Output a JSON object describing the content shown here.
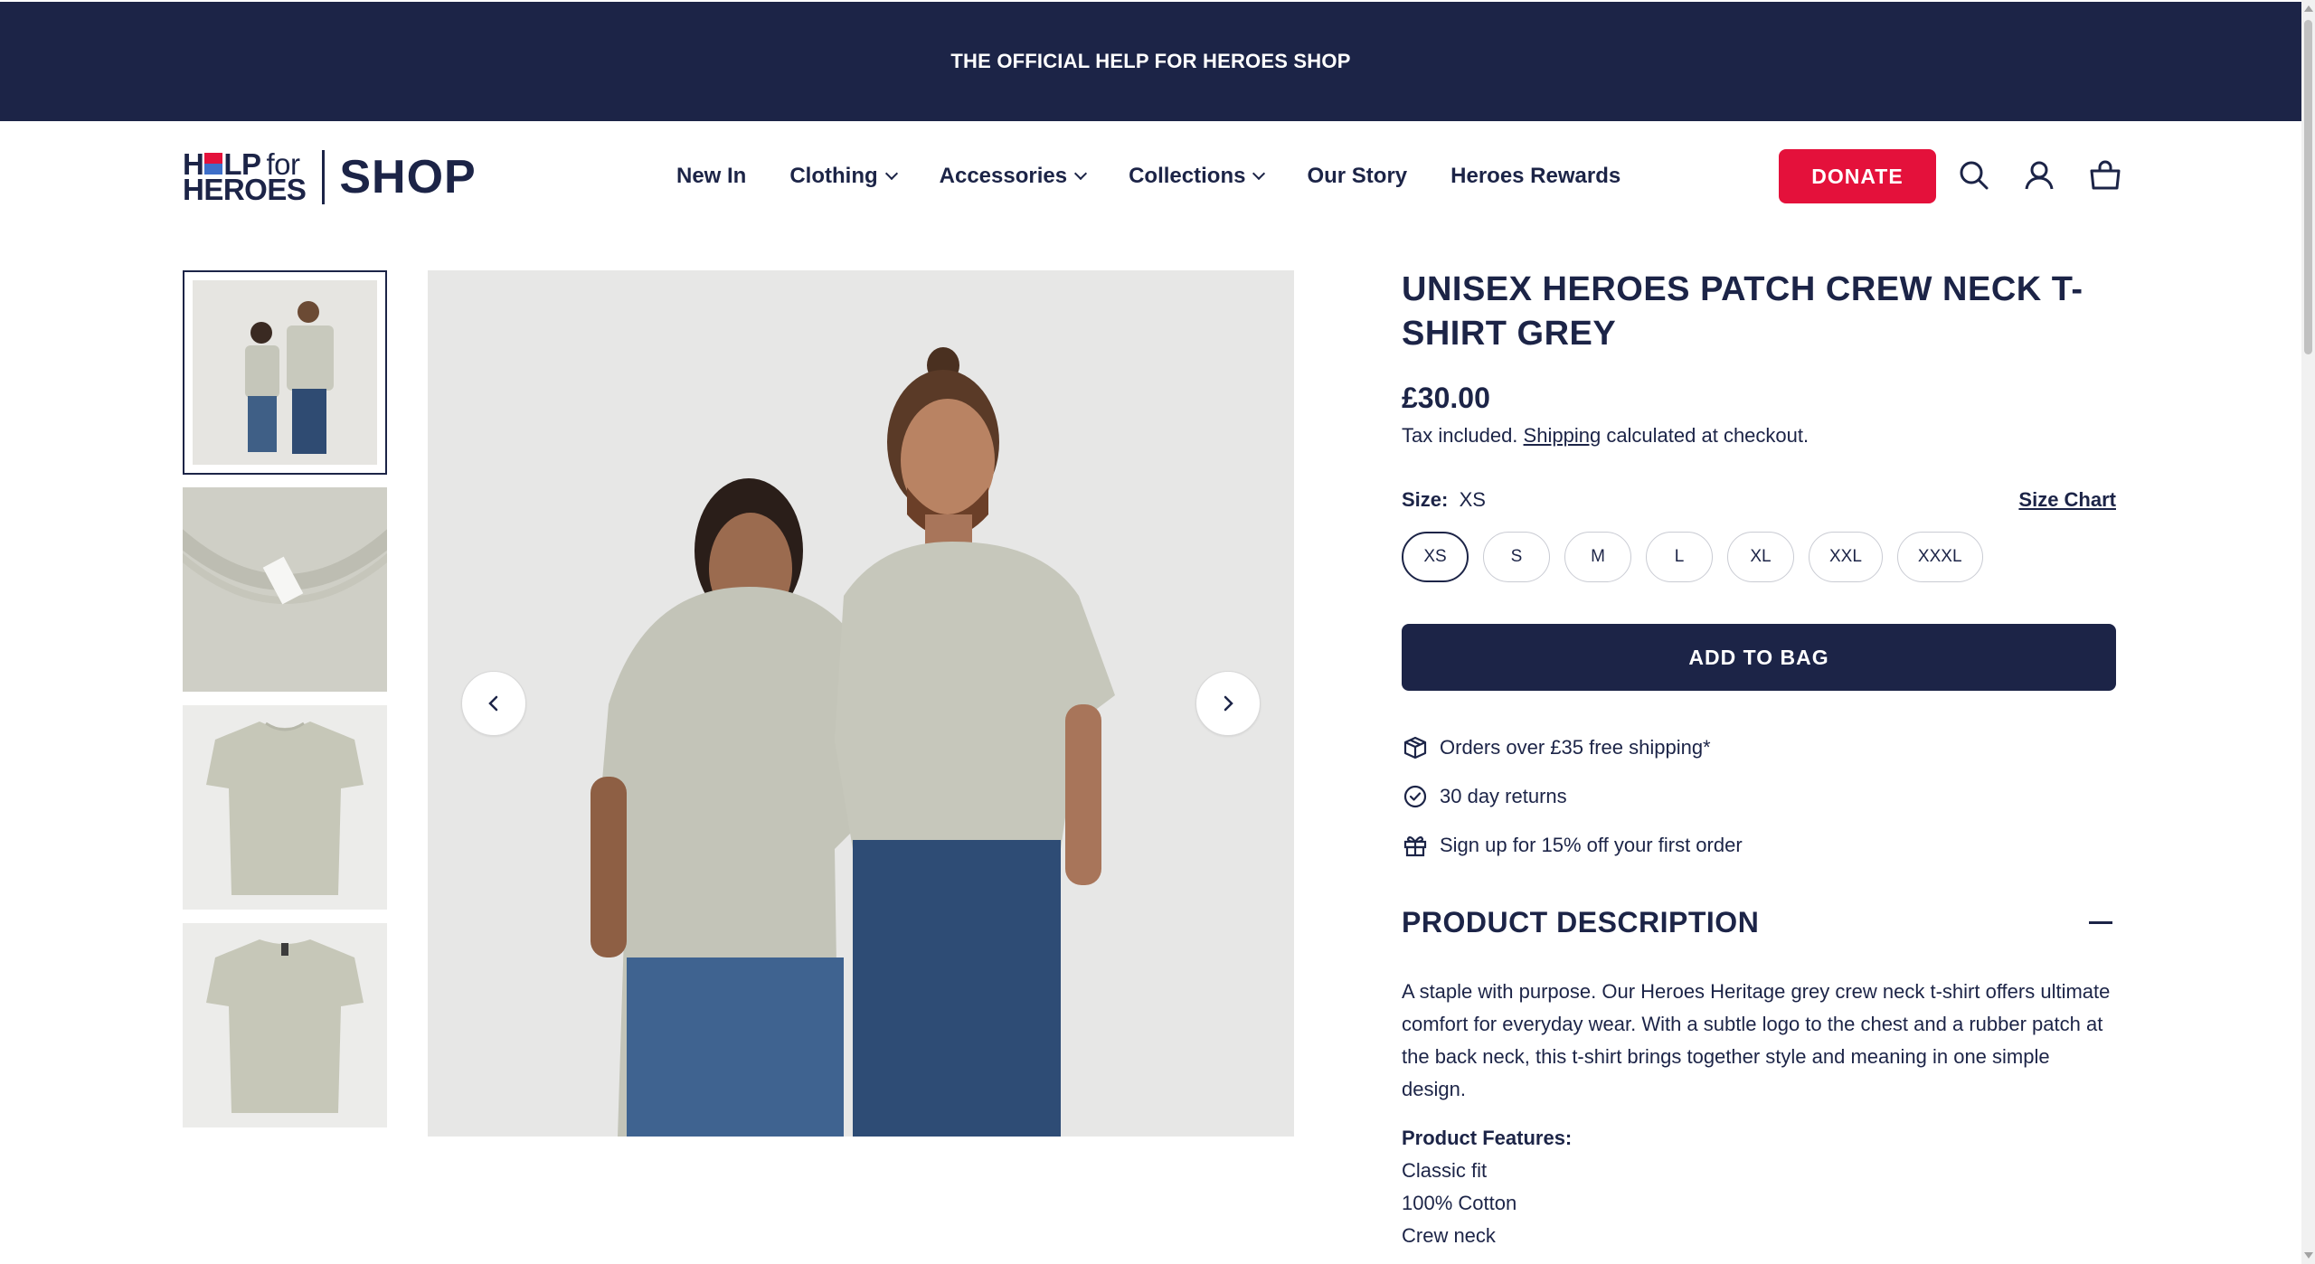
{
  "announcement": "THE OFFICIAL HELP FOR HEROES SHOP",
  "logo": {
    "help_h": "H",
    "help_lp": "LP",
    "help_for": "for",
    "heroes": "HEROES",
    "shop": "SHOP"
  },
  "nav": {
    "items": [
      {
        "label": "New In",
        "dropdown": false
      },
      {
        "label": "Clothing",
        "dropdown": true
      },
      {
        "label": "Accessories",
        "dropdown": true
      },
      {
        "label": "Collections",
        "dropdown": true
      },
      {
        "label": "Our Story",
        "dropdown": false
      },
      {
        "label": "Heroes Rewards",
        "dropdown": false
      }
    ]
  },
  "header": {
    "donate_label": "DONATE",
    "icons": [
      "search-icon",
      "account-icon",
      "bag-icon"
    ]
  },
  "gallery": {
    "thumbnails": [
      "two-models-front",
      "neck-label-closeup",
      "tshirt-front",
      "tshirt-back"
    ],
    "active_index": 0
  },
  "product": {
    "title": "UNISEX HEROES PATCH CREW NECK T-SHIRT GREY",
    "price": "£30.00",
    "tax_prefix": "Tax included.",
    "tax_link": "Shipping",
    "tax_suffix": "calculated at checkout.",
    "size_label": "Size:",
    "size_selected": "XS",
    "size_chart": "Size Chart",
    "sizes": [
      "XS",
      "S",
      "M",
      "L",
      "XL",
      "XXL",
      "XXXL"
    ],
    "add_to_bag": "ADD TO BAG",
    "perks": [
      {
        "icon": "box-icon",
        "text": "Orders over £35 free shipping*"
      },
      {
        "icon": "check-circle-icon",
        "text": "30 day returns"
      },
      {
        "icon": "gift-icon",
        "text": "Sign up for 15% off your first order"
      }
    ],
    "description_heading": "PRODUCT DESCRIPTION",
    "description": "A staple with purpose. Our Heroes Heritage grey crew neck t-shirt offers ultimate comfort for everyday wear. With a subtle logo to the chest and a rubber patch at the back neck, this t-shirt brings together style and meaning in one simple design.",
    "features_title": "Product Features:",
    "features": [
      "Classic fit",
      "100% Cotton",
      "Crew neck"
    ]
  },
  "colors": {
    "navy": "#1c2447",
    "donate_red": "#e4113b",
    "shirt_grey": "#c9c9bd"
  }
}
